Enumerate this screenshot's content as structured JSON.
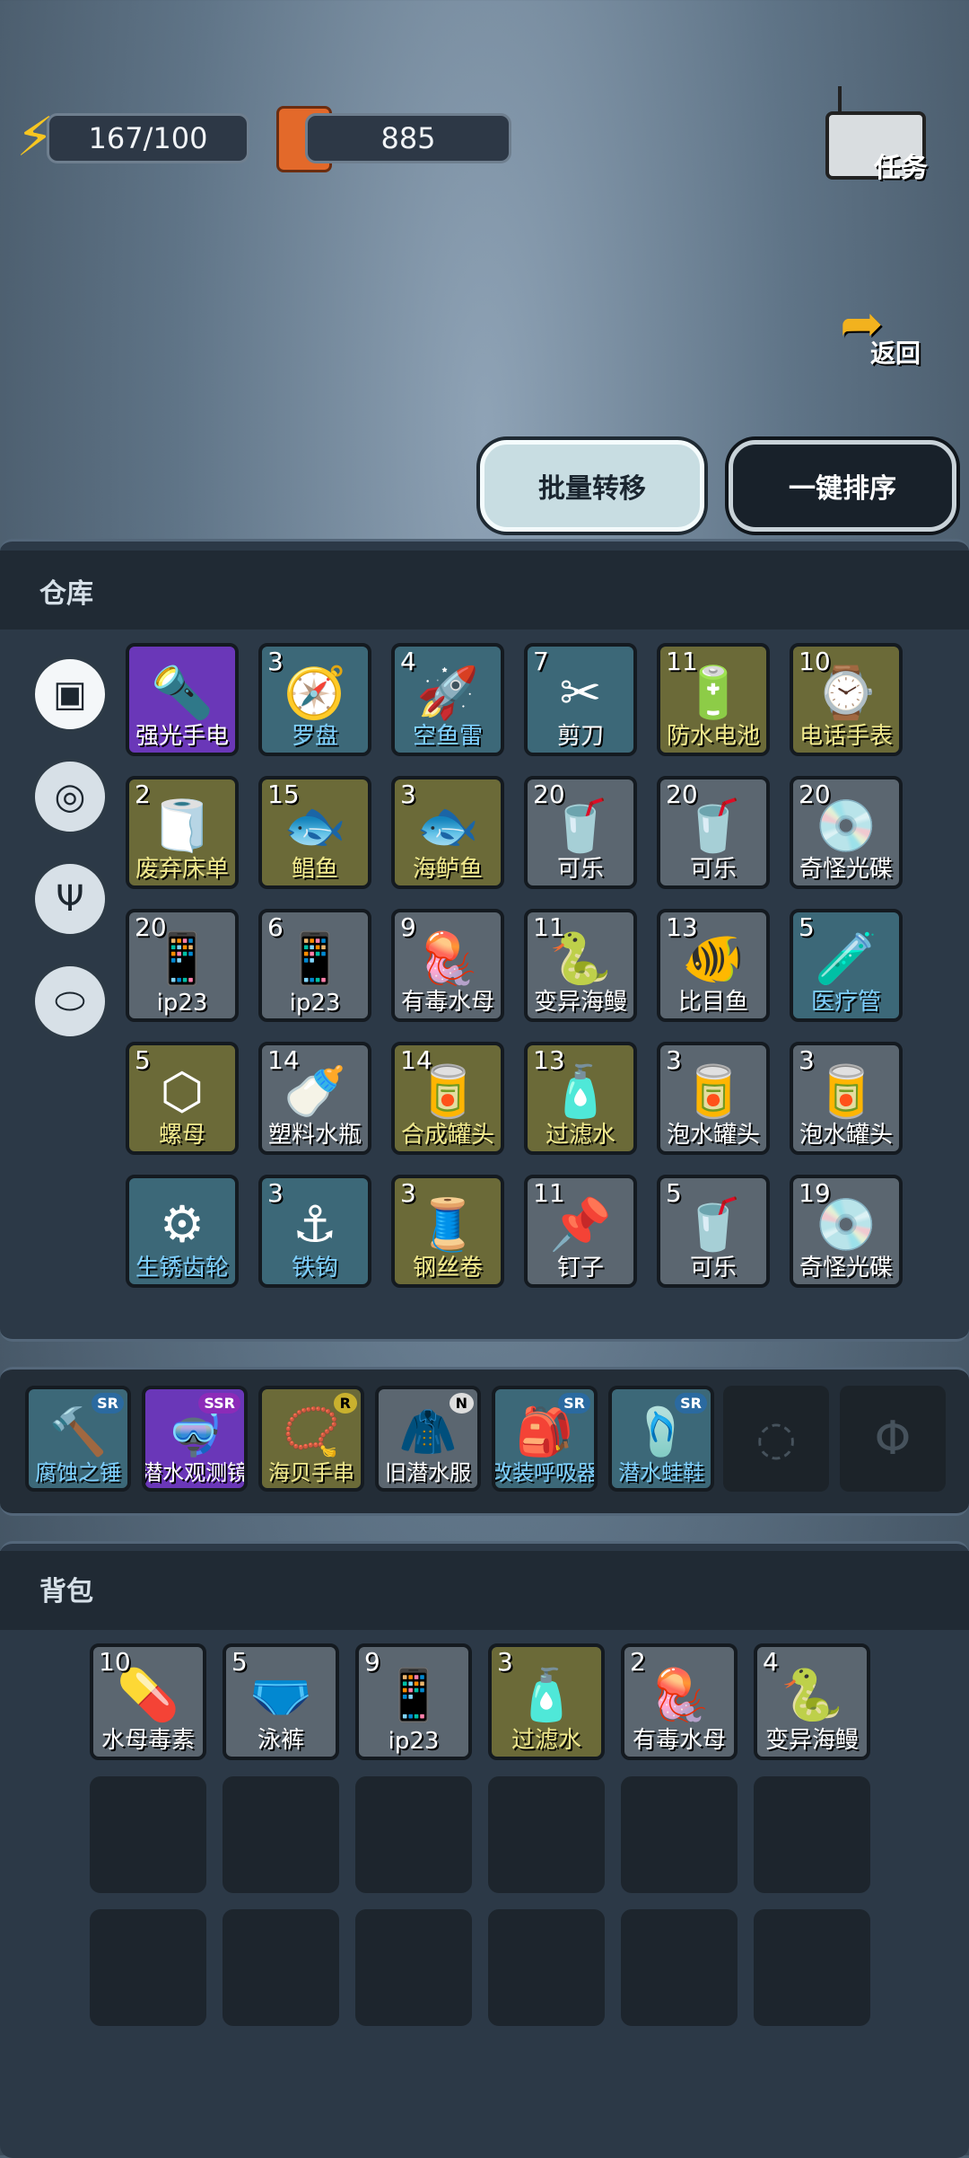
{
  "stats": {
    "energy": "167/100",
    "fuel": "885"
  },
  "top_right": {
    "task_label": "任务",
    "back_label": "返回"
  },
  "buttons": {
    "batch_transfer": "批量转移",
    "one_key_sort": "一键排序"
  },
  "warehouse": {
    "title": "仓库",
    "items": [
      {
        "count": "",
        "name": "强光手电",
        "rarity": "purple",
        "icon": "flashlight-icon",
        "glyph": "🔦",
        "color": "w"
      },
      {
        "count": "3",
        "name": "罗盘",
        "rarity": "blue",
        "icon": "compass-icon",
        "glyph": "🧭",
        "color": "b"
      },
      {
        "count": "4",
        "name": "空鱼雷",
        "rarity": "blue",
        "icon": "torpedo-icon",
        "glyph": "🚀",
        "color": "b"
      },
      {
        "count": "7",
        "name": "剪刀",
        "rarity": "blue",
        "icon": "scissors-icon",
        "glyph": "✂",
        "color": "w"
      },
      {
        "count": "11",
        "name": "防水电池",
        "rarity": "olive",
        "icon": "battery-icon",
        "glyph": "🔋",
        "color": "y"
      },
      {
        "count": "10",
        "name": "电话手表",
        "rarity": "olive",
        "icon": "watch-icon",
        "glyph": "⌚",
        "color": "y"
      },
      {
        "count": "2",
        "name": "废弃床单",
        "rarity": "olive",
        "icon": "bedsheet-icon",
        "glyph": "🧻",
        "color": "y"
      },
      {
        "count": "15",
        "name": "鲳鱼",
        "rarity": "olive",
        "icon": "fish-icon",
        "glyph": "🐟",
        "color": "y"
      },
      {
        "count": "3",
        "name": "海鲈鱼",
        "rarity": "olive",
        "icon": "bass-icon",
        "glyph": "🐟",
        "color": "y"
      },
      {
        "count": "20",
        "name": "可乐",
        "rarity": "gray",
        "icon": "cola-can-icon",
        "glyph": "🥤",
        "color": "w"
      },
      {
        "count": "20",
        "name": "可乐",
        "rarity": "gray",
        "icon": "cola-can-icon",
        "glyph": "🥤",
        "color": "w"
      },
      {
        "count": "20",
        "name": "奇怪光碟",
        "rarity": "gray",
        "icon": "disc-icon",
        "glyph": "💿",
        "color": "w"
      },
      {
        "count": "20",
        "name": "ip23",
        "rarity": "gray",
        "icon": "phone-icon",
        "glyph": "📱",
        "color": "w"
      },
      {
        "count": "6",
        "name": "ip23",
        "rarity": "gray",
        "icon": "phone-icon",
        "glyph": "📱",
        "color": "w"
      },
      {
        "count": "9",
        "name": "有毒水母",
        "rarity": "gray",
        "icon": "jellyfish-icon",
        "glyph": "🪼",
        "color": "w"
      },
      {
        "count": "11",
        "name": "变异海鳗",
        "rarity": "gray",
        "icon": "eel-icon",
        "glyph": "🐍",
        "color": "w"
      },
      {
        "count": "13",
        "name": "比目鱼",
        "rarity": "gray",
        "icon": "flatfish-icon",
        "glyph": "🐠",
        "color": "w"
      },
      {
        "count": "5",
        "name": "医疗管",
        "rarity": "blue",
        "icon": "medical-tube-icon",
        "glyph": "🧪",
        "color": "b"
      },
      {
        "count": "5",
        "name": "螺母",
        "rarity": "olive",
        "icon": "nut-icon",
        "glyph": "⬡",
        "color": "y"
      },
      {
        "count": "14",
        "name": "塑料水瓶",
        "rarity": "gray",
        "icon": "bottle-icon",
        "glyph": "🍼",
        "color": "w"
      },
      {
        "count": "14",
        "name": "合成罐头",
        "rarity": "olive",
        "icon": "can-icon",
        "glyph": "🥫",
        "color": "y"
      },
      {
        "count": "13",
        "name": "过滤水",
        "rarity": "olive",
        "icon": "water-bottle-icon",
        "glyph": "🧴",
        "color": "y"
      },
      {
        "count": "3",
        "name": "泡水罐头",
        "rarity": "gray",
        "icon": "can-icon",
        "glyph": "🥫",
        "color": "w"
      },
      {
        "count": "3",
        "name": "泡水罐头",
        "rarity": "gray",
        "icon": "can-icon",
        "glyph": "🥫",
        "color": "w"
      },
      {
        "count": "",
        "name": "生锈齿轮",
        "rarity": "blue",
        "icon": "gear-icon",
        "glyph": "⚙",
        "color": "b"
      },
      {
        "count": "3",
        "name": "铁钩",
        "rarity": "blue",
        "icon": "hook-icon",
        "glyph": "⚓",
        "color": "b"
      },
      {
        "count": "3",
        "name": "钢丝卷",
        "rarity": "olive",
        "icon": "wire-spool-icon",
        "glyph": "🧵",
        "color": "y"
      },
      {
        "count": "11",
        "name": "钉子",
        "rarity": "gray",
        "icon": "nail-icon",
        "glyph": "📌",
        "color": "w"
      },
      {
        "count": "5",
        "name": "可乐",
        "rarity": "gray",
        "icon": "cola-can-icon",
        "glyph": "🥤",
        "color": "w"
      },
      {
        "count": "19",
        "name": "奇怪光碟",
        "rarity": "gray",
        "icon": "disc-icon",
        "glyph": "💿",
        "color": "w"
      }
    ]
  },
  "equipment": [
    {
      "name": "腐蚀之锤",
      "grade": "SR",
      "glyph": "🔨",
      "rarity": "blue",
      "color": "b"
    },
    {
      "name": "潜水观测镜",
      "grade": "SSR",
      "glyph": "🤿",
      "rarity": "purple",
      "color": "w"
    },
    {
      "name": "海贝手串",
      "grade": "R",
      "glyph": "📿",
      "rarity": "olive",
      "color": "y"
    },
    {
      "name": "旧潜水服",
      "grade": "N",
      "glyph": "🧥",
      "rarity": "gray",
      "color": "w"
    },
    {
      "name": "改装呼吸器",
      "grade": "SR",
      "glyph": "🎒",
      "rarity": "blue",
      "color": "b"
    },
    {
      "name": "潜水蛙鞋",
      "grade": "SR",
      "glyph": "🩴",
      "rarity": "blue",
      "color": "b"
    }
  ],
  "backpack": {
    "title": "背包",
    "items": [
      {
        "count": "10",
        "name": "水母毒素",
        "rarity": "gray",
        "glyph": "💊",
        "color": "w",
        "icon": "pill-icon"
      },
      {
        "count": "5",
        "name": "泳裤",
        "rarity": "gray",
        "glyph": "🩲",
        "color": "w",
        "icon": "swim-trunks-icon"
      },
      {
        "count": "9",
        "name": "ip23",
        "rarity": "gray",
        "glyph": "📱",
        "color": "w",
        "icon": "phone-icon"
      },
      {
        "count": "3",
        "name": "过滤水",
        "rarity": "olive",
        "glyph": "🧴",
        "color": "y",
        "icon": "water-bottle-icon"
      },
      {
        "count": "2",
        "name": "有毒水母",
        "rarity": "gray",
        "glyph": "🪼",
        "color": "w",
        "icon": "jellyfish-icon"
      },
      {
        "count": "4",
        "name": "变异海鳗",
        "rarity": "gray",
        "glyph": "🐍",
        "color": "w",
        "icon": "eel-icon"
      }
    ]
  }
}
